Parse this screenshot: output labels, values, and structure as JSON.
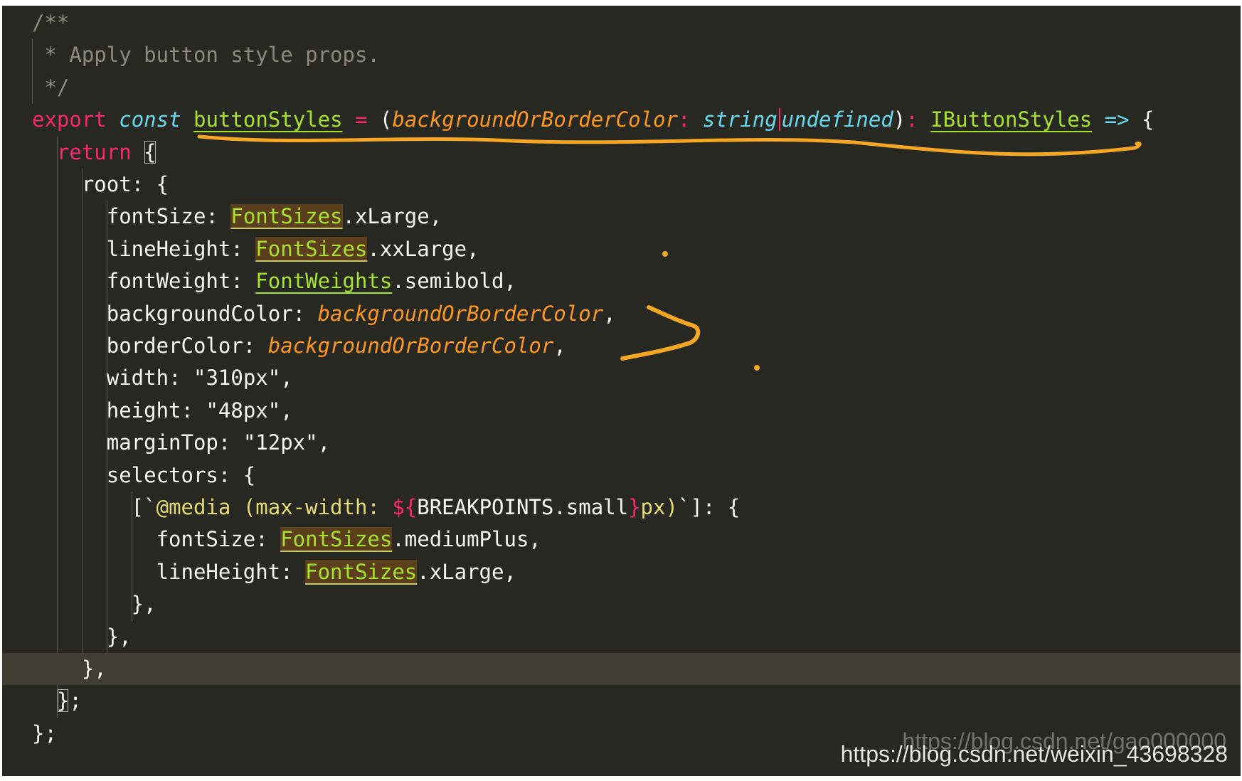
{
  "editor": {
    "lines": [
      [
        {
          "t": "/**",
          "c": "tok-comment"
        }
      ],
      [
        {
          "t": " * Apply button style props.",
          "c": "tok-comment"
        }
      ],
      [
        {
          "t": " */",
          "c": "tok-comment"
        }
      ],
      [
        {
          "t": "export",
          "c": "tok-kw"
        },
        {
          "t": " ",
          "c": "tok-plain"
        },
        {
          "t": "const",
          "c": "tok-storage"
        },
        {
          "t": " ",
          "c": "tok-plain"
        },
        {
          "t": "buttonStyles",
          "c": "tok-fn"
        },
        {
          "t": " ",
          "c": "tok-plain"
        },
        {
          "t": "=",
          "c": "tok-op"
        },
        {
          "t": " (",
          "c": "tok-plain"
        },
        {
          "t": "backgroundOrBorderColor",
          "c": "tok-param"
        },
        {
          "t": ": ",
          "c": "tok-op"
        },
        {
          "t": "string",
          "c": "tok-type"
        },
        {
          "t": "|",
          "c": "cursor-mark"
        },
        {
          "t": "undefined",
          "c": "tok-type"
        },
        {
          "t": ")",
          "c": "tok-plain"
        },
        {
          "t": ": ",
          "c": "tok-op"
        },
        {
          "t": "IButtonStyles",
          "c": "tok-type2"
        },
        {
          "t": " ",
          "c": "tok-plain"
        },
        {
          "t": "=>",
          "c": "tok-storage"
        },
        {
          "t": " {",
          "c": "tok-plain"
        }
      ],
      [
        {
          "t": "  ",
          "c": "tok-plain"
        },
        {
          "t": "return",
          "c": "tok-kw"
        },
        {
          "t": " ",
          "c": "tok-plain"
        },
        {
          "t": "{",
          "c": "tok-brace-match"
        }
      ],
      [
        {
          "t": "    root: {",
          "c": "tok-plain"
        }
      ],
      [
        {
          "t": "      fontSize: ",
          "c": "tok-plain"
        },
        {
          "t": "FontSizes",
          "c": "tok-hl"
        },
        {
          "t": ".xLarge,",
          "c": "tok-plain"
        }
      ],
      [
        {
          "t": "      lineHeight: ",
          "c": "tok-plain"
        },
        {
          "t": "FontSizes",
          "c": "tok-hl"
        },
        {
          "t": ".xxLarge,",
          "c": "tok-plain"
        }
      ],
      [
        {
          "t": "      fontWeight: ",
          "c": "tok-plain"
        },
        {
          "t": "FontWeights",
          "c": "tok-hl-soft"
        },
        {
          "t": ".semibold,",
          "c": "tok-plain"
        }
      ],
      [
        {
          "t": "      backgroundColor: ",
          "c": "tok-plain"
        },
        {
          "t": "backgroundOrBorderColor",
          "c": "tok-param"
        },
        {
          "t": ",",
          "c": "tok-plain"
        }
      ],
      [
        {
          "t": "      borderColor: ",
          "c": "tok-plain"
        },
        {
          "t": "backgroundOrBorderColor",
          "c": "tok-param"
        },
        {
          "t": ",",
          "c": "tok-plain"
        }
      ],
      [
        {
          "t": "      width: ",
          "c": "tok-plain"
        },
        {
          "t": "\"310px\"",
          "c": "tok-plain"
        },
        {
          "t": ",",
          "c": "tok-plain"
        }
      ],
      [
        {
          "t": "      height: ",
          "c": "tok-plain"
        },
        {
          "t": "\"48px\"",
          "c": "tok-plain"
        },
        {
          "t": ",",
          "c": "tok-plain"
        }
      ],
      [
        {
          "t": "      marginTop: ",
          "c": "tok-plain"
        },
        {
          "t": "\"12px\"",
          "c": "tok-plain"
        },
        {
          "t": ",",
          "c": "tok-plain"
        }
      ],
      [
        {
          "t": "      selectors: {",
          "c": "tok-plain"
        }
      ],
      [
        {
          "t": "        [`",
          "c": "tok-plain"
        },
        {
          "t": "@media (max-width: ",
          "c": "tok-str"
        },
        {
          "t": "${",
          "c": "tok-kw"
        },
        {
          "t": "BREAKPOINTS.small",
          "c": "tok-plain"
        },
        {
          "t": "}",
          "c": "tok-kw"
        },
        {
          "t": "px)",
          "c": "tok-str"
        },
        {
          "t": "`]: {",
          "c": "tok-plain"
        }
      ],
      [
        {
          "t": "          fontSize: ",
          "c": "tok-plain"
        },
        {
          "t": "FontSizes",
          "c": "tok-hl"
        },
        {
          "t": ".mediumPlus,",
          "c": "tok-plain"
        }
      ],
      [
        {
          "t": "          lineHeight: ",
          "c": "tok-plain"
        },
        {
          "t": "FontSizes",
          "c": "tok-hl"
        },
        {
          "t": ".xLarge,",
          "c": "tok-plain"
        }
      ],
      [
        {
          "t": "        },",
          "c": "tok-plain"
        }
      ],
      [
        {
          "t": "      },",
          "c": "tok-plain"
        }
      ],
      [
        {
          "t": "    },",
          "c": "tok-plain"
        }
      ],
      [
        {
          "t": "  ",
          "c": "tok-plain"
        },
        {
          "t": "}",
          "c": "tok-brace-match"
        },
        {
          "t": ";",
          "c": "tok-plain"
        }
      ],
      [
        {
          "t": "};",
          "c": "tok-plain"
        }
      ]
    ],
    "current_line_index": 20
  },
  "watermark": {
    "back_text": "https://blog.csdn.net/gao000000",
    "front_text": "https://blog.csdn.net/weixin_43698328"
  },
  "colors": {
    "background": "#272822",
    "current_line": "#3e3d32",
    "annotation_ink": "#f5a623"
  }
}
